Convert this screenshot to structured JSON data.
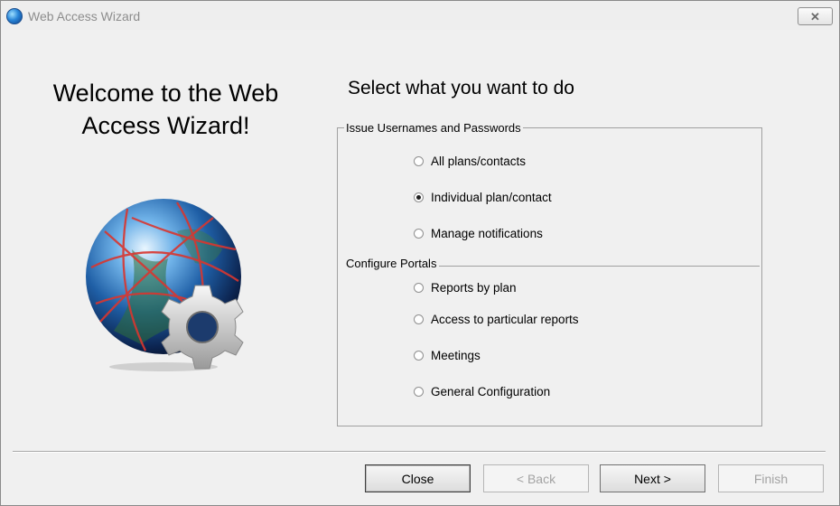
{
  "window": {
    "title": "Web Access Wizard",
    "close_glyph": "✕"
  },
  "left_panel": {
    "welcome_line1": "Welcome to the Web",
    "welcome_line2": "Access Wizard!",
    "illustration": "globe-gear-icon"
  },
  "main": {
    "heading": "Select what you want to do",
    "groups": [
      {
        "label": "Issue Usernames and Passwords",
        "options": [
          {
            "label": "All plans/contacts",
            "checked": false
          },
          {
            "label": "Individual plan/contact",
            "checked": true
          },
          {
            "label": "Manage notifications",
            "checked": false
          }
        ]
      },
      {
        "label": "Configure Portals",
        "options": [
          {
            "label": "Reports by plan",
            "checked": false
          },
          {
            "label": "Access to particular reports",
            "checked": false
          },
          {
            "label": "Meetings",
            "checked": false
          },
          {
            "label": "General Configuration",
            "checked": false
          }
        ]
      }
    ]
  },
  "buttons": {
    "close": "Close",
    "back": "< Back",
    "next": "Next >",
    "finish": "Finish",
    "back_enabled": false,
    "finish_enabled": false
  }
}
